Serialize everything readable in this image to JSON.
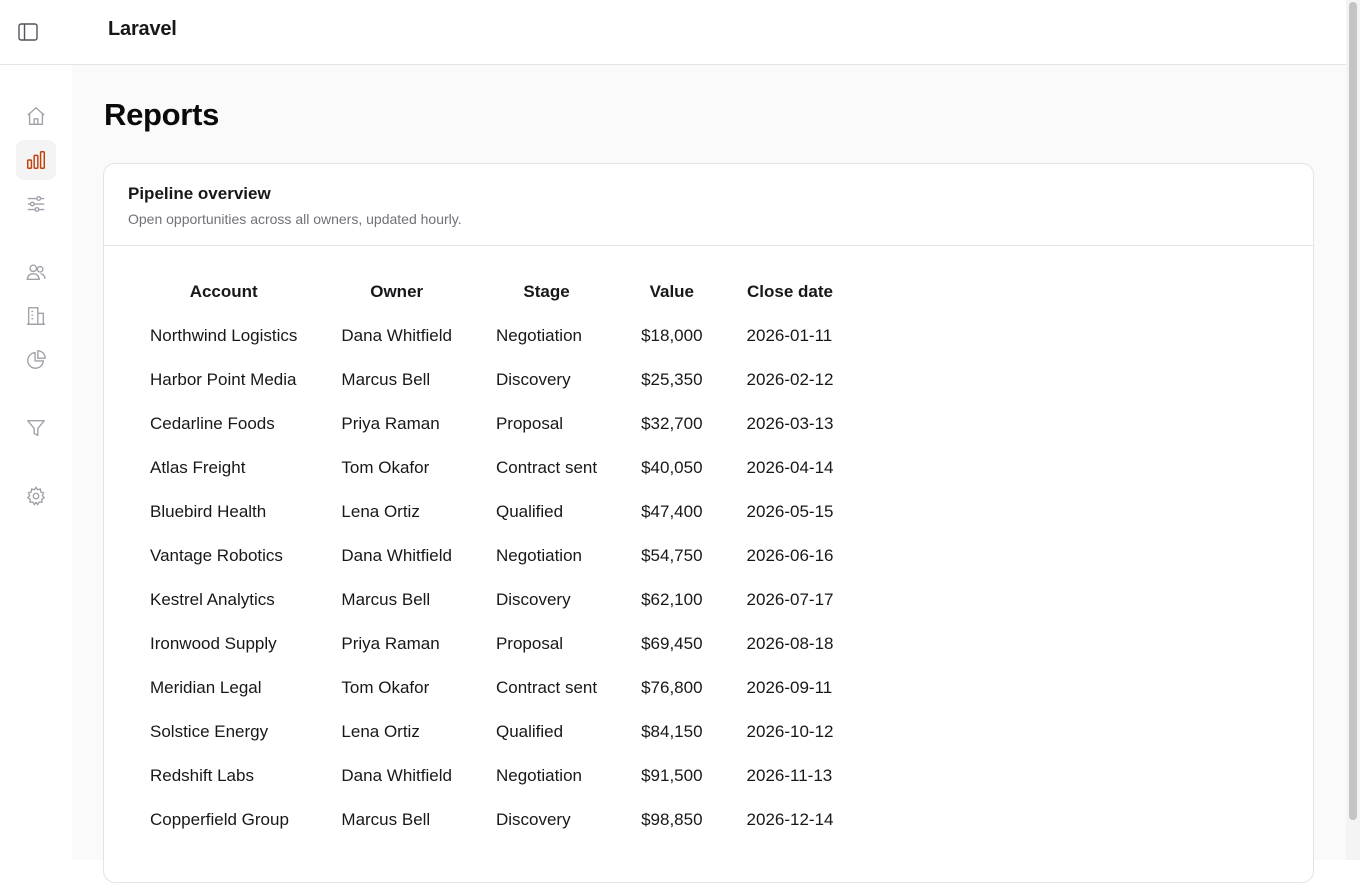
{
  "app": {
    "brand": "Laravel"
  },
  "topbar": {
    "toggle_icon": "sidebar-toggle-icon"
  },
  "sidebar": {
    "items": [
      {
        "icon": "home-icon",
        "active": false
      },
      {
        "icon": "bar-chart-icon",
        "active": true
      },
      {
        "icon": "sliders-icon",
        "active": false
      },
      {
        "icon": "users-icon",
        "active": false
      },
      {
        "icon": "building-icon",
        "active": false
      },
      {
        "icon": "pie-chart-icon",
        "active": false
      },
      {
        "icon": "filter-icon",
        "active": false
      },
      {
        "icon": "gear-icon",
        "active": false
      }
    ]
  },
  "page": {
    "title": "Reports"
  },
  "card": {
    "title": "Pipeline overview",
    "subtitle": "Open opportunities across all owners, updated hourly."
  },
  "table": {
    "columns": [
      "Account",
      "Owner",
      "Stage",
      "Value",
      "Close date"
    ],
    "rows": [
      [
        "Northwind Logistics",
        "Dana Whitfield",
        "Negotiation",
        "$18,000",
        "2026-01-11"
      ],
      [
        "Harbor Point Media",
        "Marcus Bell",
        "Discovery",
        "$25,350",
        "2026-02-12"
      ],
      [
        "Cedarline Foods",
        "Priya Raman",
        "Proposal",
        "$32,700",
        "2026-03-13"
      ],
      [
        "Atlas Freight",
        "Tom Okafor",
        "Contract sent",
        "$40,050",
        "2026-04-14"
      ],
      [
        "Bluebird Health",
        "Lena Ortiz",
        "Qualified",
        "$47,400",
        "2026-05-15"
      ],
      [
        "Vantage Robotics",
        "Dana Whitfield",
        "Negotiation",
        "$54,750",
        "2026-06-16"
      ],
      [
        "Kestrel Analytics",
        "Marcus Bell",
        "Discovery",
        "$62,100",
        "2026-07-17"
      ],
      [
        "Ironwood Supply",
        "Priya Raman",
        "Proposal",
        "$69,450",
        "2026-08-18"
      ],
      [
        "Meridian Legal",
        "Tom Okafor",
        "Contract sent",
        "$76,800",
        "2026-09-11"
      ],
      [
        "Solstice Energy",
        "Lena Ortiz",
        "Qualified",
        "$84,150",
        "2026-10-12"
      ],
      [
        "Redshift Labs",
        "Dana Whitfield",
        "Negotiation",
        "$91,500",
        "2026-11-13"
      ],
      [
        "Copperfield Group",
        "Marcus Bell",
        "Discovery",
        "$98,850",
        "2026-12-14"
      ]
    ]
  },
  "colors": {
    "accent": "#c2410c",
    "icon": "#a1a1aa",
    "border": "#e4e4e7"
  }
}
